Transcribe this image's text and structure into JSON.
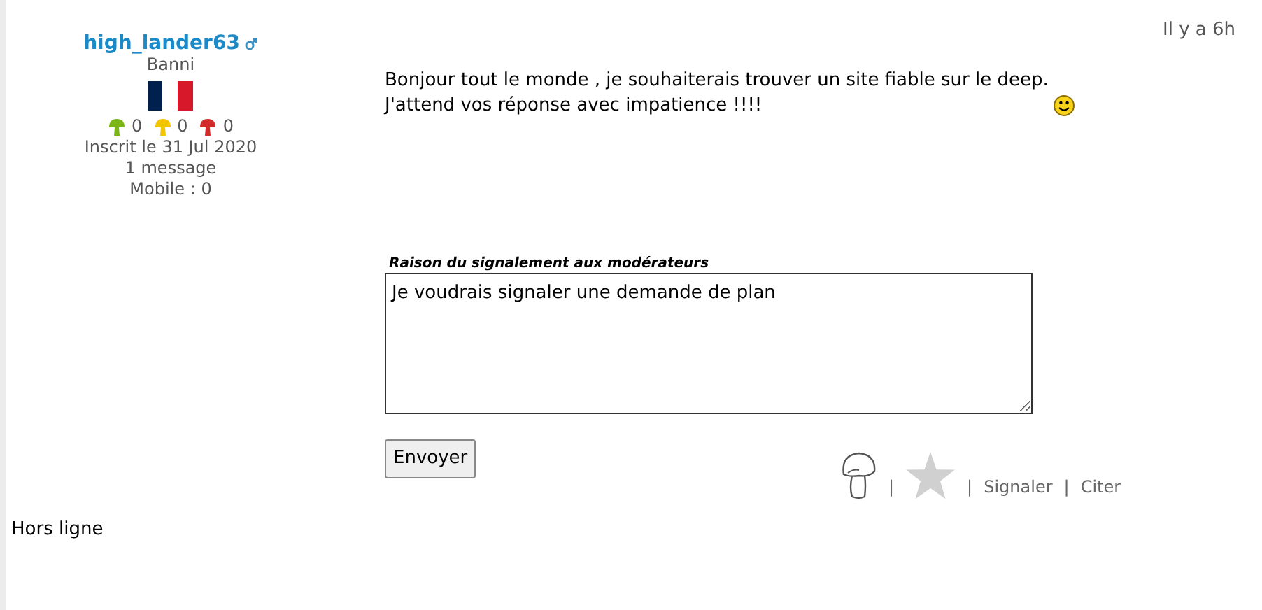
{
  "author": {
    "name": "high_lander63",
    "rank": "Banni",
    "reputation": [
      {
        "color": "#7cb518",
        "count": "0"
      },
      {
        "color": "#f2c500",
        "count": "0"
      },
      {
        "color": "#d12b2b",
        "count": "0"
      }
    ],
    "registered": "Inscrit le 31 Jul 2020",
    "messages": "1 message",
    "mobile": "Mobile : 0"
  },
  "post": {
    "time": "Il y a 6h",
    "text": "Bonjour tout le monde , je souhaiterais trouver un site fiable sur le deep.\nJ'attend vos réponse avec impatience !!!!"
  },
  "report": {
    "label": "Raison du signalement aux modérateurs",
    "value": "Je voudrais signaler une demande de plan",
    "button": "Envoyer"
  },
  "status": "Hors ligne",
  "actions": [
    {
      "kind": "mushroom"
    },
    {
      "kind": "separator",
      "text": "|"
    },
    {
      "kind": "star"
    },
    {
      "kind": "separator",
      "text": "|"
    },
    {
      "kind": "link",
      "text": "Signaler"
    },
    {
      "kind": "separator",
      "text": "|"
    },
    {
      "kind": "link",
      "text": "Citer"
    }
  ]
}
